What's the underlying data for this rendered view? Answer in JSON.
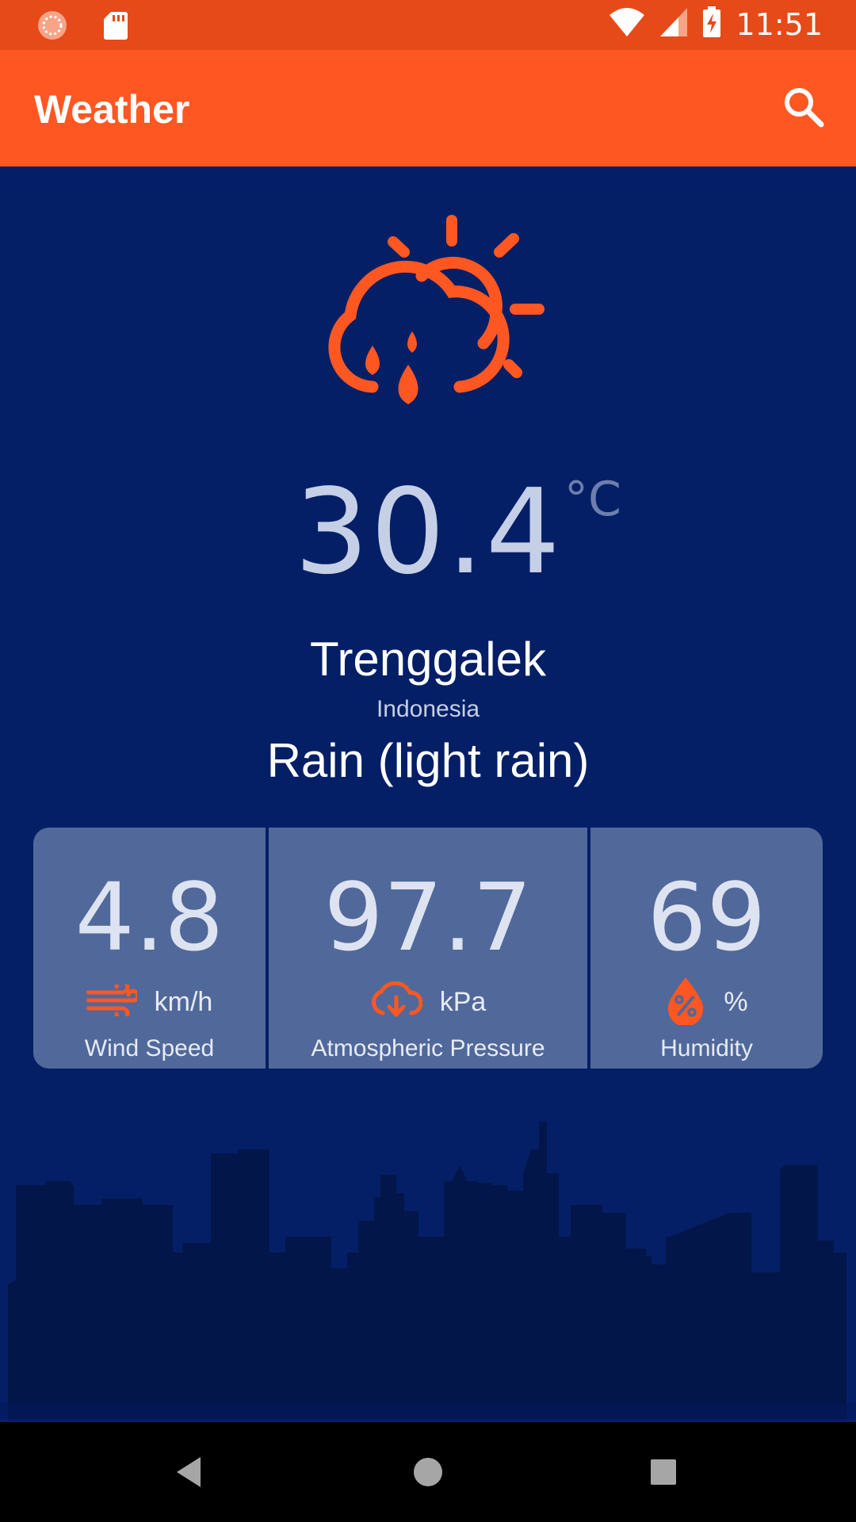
{
  "status_bar": {
    "time": "11:51",
    "icons": [
      "loading-icon",
      "sd-card-icon",
      "wifi-icon",
      "signal-icon",
      "battery-charging-icon"
    ]
  },
  "app_bar": {
    "title": "Weather",
    "search_icon": "search-icon"
  },
  "weather": {
    "icon": "partly-cloudy-rain-icon",
    "temperature": "30.4",
    "unit": "°C",
    "city": "Trenggalek",
    "country": "Indonesia",
    "condition": "Rain (light rain)"
  },
  "stats": {
    "wind": {
      "value": "4.8",
      "unit": "km/h",
      "label": "Wind Speed",
      "icon": "wind-icon"
    },
    "pressure": {
      "value": "97.7",
      "unit": "kPa",
      "label": "Atmospheric Pressure",
      "icon": "cloud-download-icon"
    },
    "humidity": {
      "value": "69",
      "unit": "%",
      "label": "Humidity",
      "icon": "humidity-drop-icon"
    }
  },
  "colors": {
    "status_bar": "#e64a19",
    "app_bar": "#ff5722",
    "background": "#041f66",
    "accent": "#ff5722",
    "panel": "#51689a",
    "skyline": "#02164a"
  },
  "nav_bar": {
    "icons": [
      "back-icon",
      "home-icon",
      "recents-icon"
    ]
  }
}
